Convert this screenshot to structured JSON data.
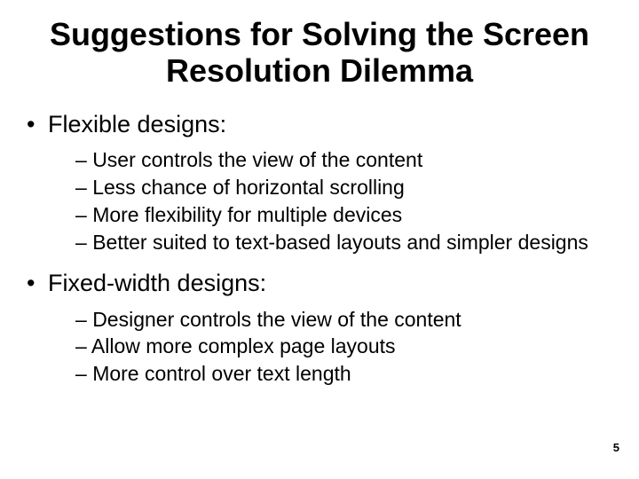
{
  "slide": {
    "title": "Suggestions for Solving the Screen Resolution Dilemma",
    "sections": [
      {
        "heading": "Flexible designs:",
        "items": [
          "User controls the view of the content",
          "Less chance of horizontal scrolling",
          "More flexibility for multiple devices",
          "Better suited to text-based layouts and simpler designs"
        ]
      },
      {
        "heading": "Fixed-width designs:",
        "items": [
          "Designer controls the view of the content",
          "Allow more complex page layouts",
          "More control over text length"
        ]
      }
    ],
    "page_number": "5"
  }
}
